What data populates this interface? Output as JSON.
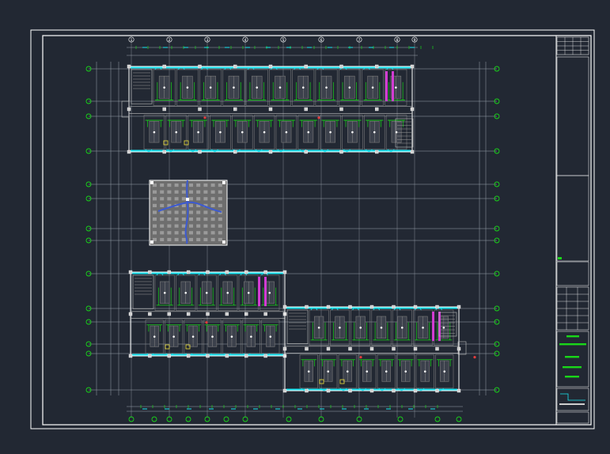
{
  "drawing": {
    "caption": "",
    "colors": {
      "background": "#222833",
      "frame": "#ffffff",
      "grid": "#9aa3ad",
      "walls": "#ffffff",
      "cyan": "#19e6f2",
      "green": "#19d619",
      "magenta": "#d23cd2",
      "blue": "#3c5ad2",
      "yellow": "#f0e13c",
      "red": "#e63c3c",
      "fill": "#6e6e6e"
    },
    "grid_bubbles_top": [
      "1",
      "2",
      "3",
      "4",
      "5",
      "6",
      "7",
      "8",
      "9"
    ],
    "title_block": {
      "rows": 17
    }
  }
}
